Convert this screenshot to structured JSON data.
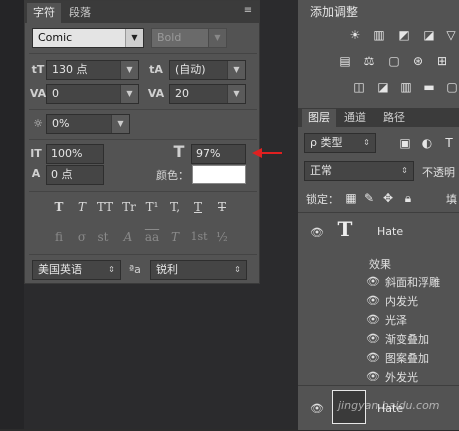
{
  "character_panel": {
    "tabs": [
      "字符",
      "段落"
    ],
    "font_family": "Comic",
    "font_style": "Bold",
    "font_size": "130 点",
    "leading": "(自动)",
    "kerning": "0",
    "tracking": "20",
    "tsume": "0%",
    "vertical_scale": "100%",
    "horizontal_scale": "97%",
    "baseline_shift": "0 点",
    "color_label": "颜色：",
    "color_value": "#ffffff",
    "style_buttons": [
      "T",
      "T",
      "TT",
      "Tr",
      "T¹",
      "T,",
      "T",
      "T"
    ],
    "opentype_buttons": [
      "fi",
      "σ",
      "st",
      "A",
      "aa",
      "T",
      "1st",
      "½"
    ],
    "language": "美国英语",
    "aa_label": "ªa",
    "antialias": "锐利",
    "icon_font_size": "tT",
    "icon_leading": "tA",
    "icon_kerning": "VA",
    "icon_tracking": "VA",
    "icon_tsume": "☼",
    "icon_vscale": "IT",
    "icon_hscale": "T",
    "icon_baseline": "A",
    "menu_icon": "≡"
  },
  "adjustments_panel": {
    "title": "添加调整",
    "row1_icons": [
      "☀",
      "▥",
      "◩",
      "◪",
      "▽"
    ],
    "row2_icons": [
      "▤",
      "⚖",
      "▢",
      "⊛",
      "⊞"
    ],
    "row3_icons": [
      "◫",
      "◪",
      "▥",
      "▬",
      "▢"
    ]
  },
  "layers_panel": {
    "tabs": [
      "图层",
      "通道",
      "路径"
    ],
    "filter": "ρ 类型",
    "blend_mode": "正常",
    "opacity_label": "不透明",
    "lock_label": "锁定：",
    "fill_label": "填",
    "layer_name": "Hate",
    "layer_thumb": "T",
    "effects_label": "效果",
    "effects": [
      "斜面和浮雕",
      "内发光",
      "光泽",
      "渐变叠加",
      "图案叠加",
      "外发光"
    ],
    "layer2_name": "Hate"
  },
  "watermark": "jingyan.baidu.com"
}
